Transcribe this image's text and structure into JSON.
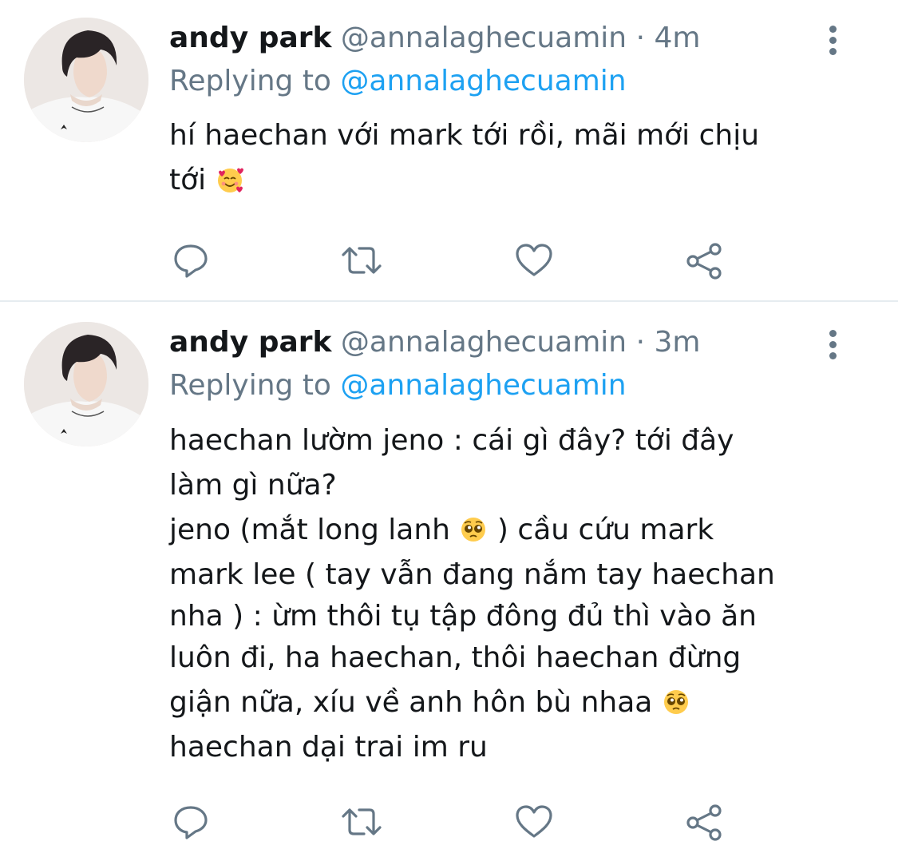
{
  "tweets": [
    {
      "author_name": "andy park",
      "handle": "@annalaghecuamin",
      "separator": "·",
      "time": "4m",
      "replying_label": "Replying to",
      "replying_to": "@annalaghecuamin",
      "lines": [
        "hí haechan với mark tới rồi, mãi mới chịu",
        "tới"
      ],
      "emoji": [
        "smiling-face-with-hearts"
      ]
    },
    {
      "author_name": "andy park",
      "handle": "@annalaghecuamin",
      "separator": "·",
      "time": "3m",
      "replying_label": "Replying to",
      "replying_to": "@annalaghecuamin",
      "lines": [
        "haechan lườm jeno : cái gì đây? tới đây",
        "làm gì nữa?",
        "jeno (mắt long lanh",
        ") cầu cứu mark",
        "mark lee ( tay vẫn đang nắm tay haechan",
        "nha ) : ừm thôi tụ tập đông đủ thì vào ăn",
        "luôn đi, ha haechan, thôi haechan đừng",
        "giận nữa, xíu về anh hôn bù nhaa",
        "haechan dại trai im ru"
      ],
      "emoji": [
        "pleading-face",
        "pleading-face"
      ]
    }
  ],
  "action_icons": [
    "reply-icon",
    "retweet-icon",
    "like-icon",
    "share-icon"
  ],
  "colors": {
    "text": "#14171a",
    "secondary": "#657786",
    "accent": "#1da1f2",
    "divider": "#e6ecf0"
  }
}
